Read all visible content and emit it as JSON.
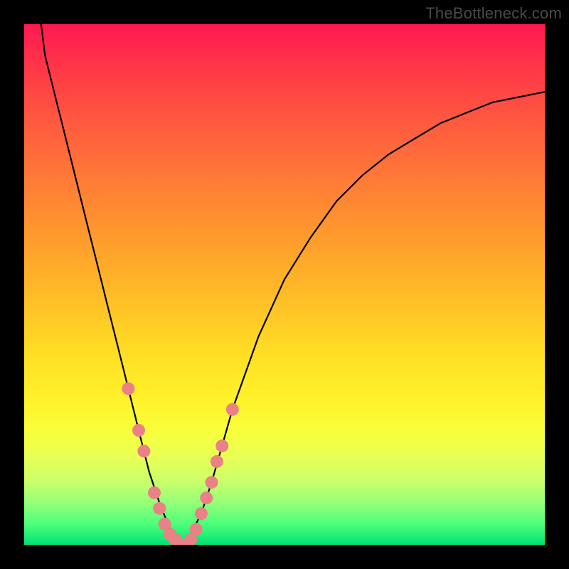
{
  "watermark": "TheBottleneck.com",
  "chart_data": {
    "type": "line",
    "title": "",
    "xlabel": "",
    "ylabel": "",
    "xlim": [
      0,
      100
    ],
    "ylim": [
      0,
      100
    ],
    "grid": false,
    "legend": false,
    "series": [
      {
        "name": "bottleneck-curve",
        "x": [
          0,
          2,
          4,
          6,
          8,
          10,
          12,
          14,
          16,
          18,
          20,
          22,
          24,
          26,
          28,
          30,
          32,
          34,
          36,
          38,
          40,
          45,
          50,
          55,
          60,
          65,
          70,
          75,
          80,
          85,
          90,
          95,
          100
        ],
        "values": [
          110,
          102,
          94,
          86,
          78,
          70,
          62,
          54,
          46,
          38,
          30,
          22,
          14,
          8,
          3,
          0,
          2,
          6,
          12,
          19,
          26,
          40,
          51,
          59,
          66,
          71,
          75,
          78,
          81,
          83,
          85,
          86,
          87
        ]
      }
    ],
    "markers": {
      "name": "highlighted-points",
      "color": "#e98186",
      "x": [
        20,
        22,
        23,
        25,
        26,
        27,
        28,
        29,
        30,
        31,
        32,
        33,
        34,
        35,
        36,
        37,
        38,
        40
      ],
      "values": [
        30,
        22,
        18,
        10,
        7,
        4,
        2,
        1,
        0,
        0,
        1,
        3,
        6,
        9,
        12,
        16,
        19,
        26
      ]
    },
    "gradient_stops": [
      {
        "pct": 0,
        "color": "#ff1951"
      },
      {
        "pct": 50,
        "color": "#ffc226"
      },
      {
        "pct": 78,
        "color": "#f8ff3a"
      },
      {
        "pct": 100,
        "color": "#00e173"
      }
    ]
  }
}
